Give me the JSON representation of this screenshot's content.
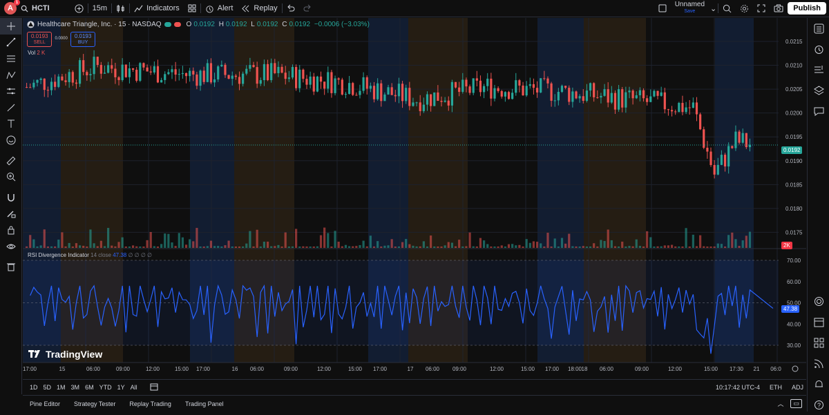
{
  "topbar": {
    "avatar_letter": "A",
    "avatar_badge": "1",
    "symbol": "HCTI",
    "interval": "15m",
    "indicators_label": "Indicators",
    "alert_label": "Alert",
    "replay_label": "Replay",
    "layout_name": "Unnamed",
    "layout_status": "Save",
    "publish_label": "Publish"
  },
  "legend": {
    "title": "Healthcare Triangle, Inc. · 15 · NASDAQ",
    "o_label": "O",
    "o_value": "0.0192",
    "h_label": "H",
    "h_value": "0.0192",
    "l_label": "L",
    "l_value": "0.0192",
    "c_label": "C",
    "c_value": "0.0192",
    "change": "−0.0006 (−3.03%)",
    "sell_price": "0.0193",
    "sell_label": "SELL",
    "spread": "0.0000",
    "buy_price": "0.0193",
    "buy_label": "BUY",
    "vol_label": "Vol",
    "vol_value": "2 K",
    "rsi_label": "RSI Divergence Indicator",
    "rsi_params": "14 close",
    "rsi_value": "47.38",
    "rsi_extra": "∅ ∅ ∅ ∅",
    "watermark": "TradingView"
  },
  "price_badge": "0.0192",
  "vol_badge": "2K",
  "rsi_badge": "47.38",
  "colors": {
    "up": "#26a69a",
    "down": "#ef5350",
    "rsi": "#2962ff",
    "accent": "#2962ff"
  },
  "price_axis": [
    "0.0215",
    "0.0210",
    "0.0205",
    "0.0200",
    "0.0195",
    "0.0190",
    "0.0185",
    "0.0180",
    "0.0175"
  ],
  "rsi_axis": [
    "70.00",
    "60.00",
    "50.00",
    "40.00",
    "30.00"
  ],
  "time_axis": [
    "17:00",
    "15",
    "06:00",
    "09:00",
    "12:00",
    "15:00",
    "17:00",
    "16",
    "06:00",
    "09:00",
    "12:00",
    "15:00",
    "17:00",
    "17",
    "06:00",
    "09:00",
    "12:00",
    "15:00",
    "17:00",
    "18:00",
    "18",
    "06:00",
    "09:00",
    "12:00",
    "15:00",
    "17:30",
    "21",
    "06:0"
  ],
  "ranges": [
    "1D",
    "5D",
    "1M",
    "3M",
    "6M",
    "YTD",
    "1Y",
    "All"
  ],
  "clock": "10:17:42 UTC-4",
  "session": "ETH",
  "adj": "ADJ",
  "panels": [
    "Pine Editor",
    "Strategy Tester",
    "Replay Trading",
    "Trading Panel"
  ],
  "chart_data": {
    "type": "candlestick",
    "ylim": [
      0.0172,
      0.0218
    ],
    "last_close": 0.0192,
    "rsi_levels": [
      70,
      50,
      30
    ],
    "rsi_ylim": [
      24,
      73
    ],
    "rsi_last": 47.38
  }
}
